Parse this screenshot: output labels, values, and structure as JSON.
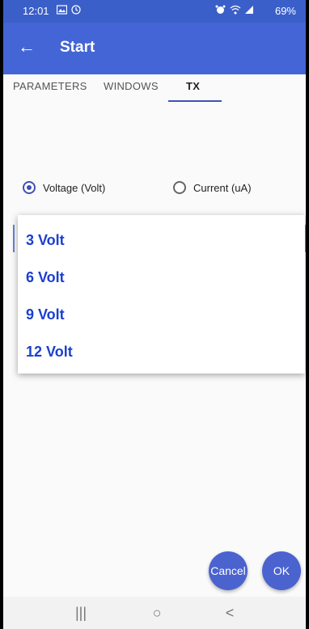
{
  "status_bar": {
    "time": "12:01",
    "battery": "69%",
    "icons": [
      "gallery-icon",
      "clock-icon",
      "alarm-icon",
      "wifi-icon",
      "signal-icon",
      "battery-icon"
    ]
  },
  "app_bar": {
    "title": "Start",
    "back_icon": "←"
  },
  "tabs": [
    {
      "label": "PARAMETERS",
      "active": false
    },
    {
      "label": "WINDOWS",
      "active": false
    },
    {
      "label": "TX",
      "active": true
    }
  ],
  "radio_group": {
    "options": [
      {
        "label": "Voltage (Volt)",
        "checked": true
      },
      {
        "label": "Current (uA)",
        "checked": false
      }
    ]
  },
  "dropdown": {
    "items": [
      "3 Volt",
      "6 Volt",
      "9 Volt",
      "12 Volt"
    ]
  },
  "actions": {
    "cancel_label": "Cancel",
    "ok_label": "OK"
  },
  "nav_bar": {
    "recents": "|||",
    "home": "○",
    "back": "<"
  },
  "colors": {
    "primary": "#4465d5",
    "status_bar": "#3b5fc9",
    "accent": "#3f51b5",
    "dropdown_text": "#1a3fd0",
    "fab": "#4a63cf"
  }
}
